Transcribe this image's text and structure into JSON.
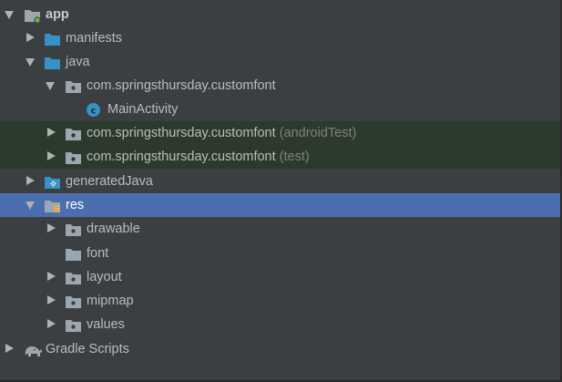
{
  "tree": {
    "app_label": "app",
    "manifests_label": "manifests",
    "java_label": "java",
    "pkg_main_label": "com.springsthursday.customfont",
    "main_activity_label": "MainActivity",
    "pkg_android_test_label": "com.springsthursday.customfont",
    "pkg_android_test_suffix": "(androidTest)",
    "pkg_test_label": "com.springsthursday.customfont",
    "pkg_test_suffix": "(test)",
    "generated_java_label": "generatedJava",
    "res_label": "res",
    "drawable_label": "drawable",
    "font_label": "font",
    "layout_label": "layout",
    "mipmap_label": "mipmap",
    "values_label": "values",
    "gradle_scripts_label": "Gradle Scripts"
  },
  "colors": {
    "background": "#3c3f41",
    "selection": "#4b6eaf",
    "test_background": "#2c3a2c",
    "text": "#bbbbbb",
    "folder_blue": "#3592c4",
    "folder_grey": "#9aa7b0",
    "class_circle": "#3592c4"
  },
  "icons": {
    "app": "module-folder-icon",
    "manifests": "source-folder-icon",
    "java": "source-folder-icon",
    "package": "package-folder-icon",
    "class": "class-c-icon",
    "generated": "generated-folder-icon",
    "res": "resource-folder-icon",
    "folder": "folder-icon",
    "gradle": "gradle-elephant-icon"
  }
}
